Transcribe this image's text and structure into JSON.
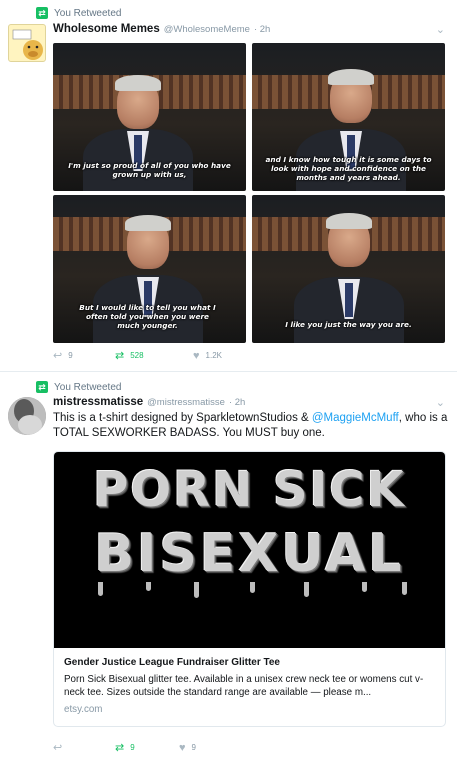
{
  "tweets": [
    {
      "retweet_label": "You Retweeted",
      "name": "Wholesome Memes",
      "handle": "@WholesomeMeme",
      "time": "· 2h",
      "photos": [
        {
          "caption": "I'm just so proud of all of you who have grown up with us,"
        },
        {
          "caption": "and I know how tough it is some days to look with hope and confidence on the months and years ahead."
        },
        {
          "caption": "But I would like to tell you what I often told you when you were much younger."
        },
        {
          "caption": "I like you just the way you are."
        }
      ],
      "actions": {
        "reply_count": "9",
        "retweet_count": "528",
        "like_count": "1.2K"
      }
    },
    {
      "retweet_label": "You Retweeted",
      "name": "mistressmatisse",
      "handle": "@mistressmatisse",
      "time": "· 2h",
      "text_before": "This is a t-shirt designed by SparkletownStudios & ",
      "mention": "@MaggieMcMuff",
      "text_after": ", who is a TOTAL SEXWORKER BADASS. You MUST buy one.",
      "card": {
        "image_line1": "PORN SICK",
        "image_line2": "BISEXUAL",
        "title": "Gender Justice League Fundraiser Glitter Tee",
        "description": "Porn Sick Bisexual glitter tee. Available in a unisex crew neck tee or womens cut v-neck tee. Sizes outside the standard range are available — please m...",
        "domain": "etsy.com"
      },
      "actions": {
        "reply_count": "",
        "retweet_count": "9",
        "like_count": "9"
      }
    }
  ],
  "icons": {
    "retweet_indicator": "retweet-icon",
    "reply": "reply-icon",
    "retweet": "retweet-icon",
    "like": "heart-icon",
    "caret": "chevron-down-icon"
  },
  "colors": {
    "retweet_green": "#17bf63",
    "link_blue": "#1da1f2",
    "muted": "#8899a6"
  }
}
